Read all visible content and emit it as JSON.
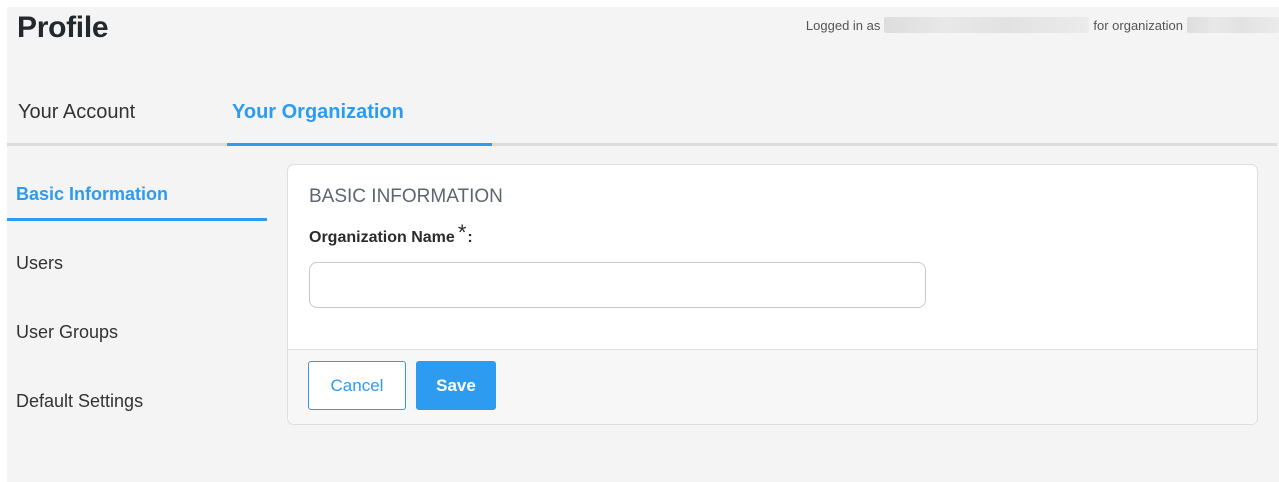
{
  "page": {
    "title": "Profile"
  },
  "login": {
    "prefix": "Logged in as",
    "middle": "for organization"
  },
  "tabs": [
    {
      "label": "Your Account",
      "active": false
    },
    {
      "label": "Your Organization",
      "active": true
    }
  ],
  "sidebar": {
    "items": [
      {
        "label": "Basic Information",
        "active": true
      },
      {
        "label": "Users",
        "active": false
      },
      {
        "label": "User Groups",
        "active": false
      },
      {
        "label": "Default Settings",
        "active": false
      }
    ]
  },
  "form": {
    "section_title": "BASIC INFORMATION",
    "org_name_label": "Organization Name",
    "required_mark": "*",
    "label_suffix": ":",
    "org_name_value": "",
    "cancel_label": "Cancel",
    "save_label": "Save"
  },
  "colors": {
    "accent": "#2c9bf0",
    "background": "#f4f4f4",
    "card": "#ffffff"
  }
}
